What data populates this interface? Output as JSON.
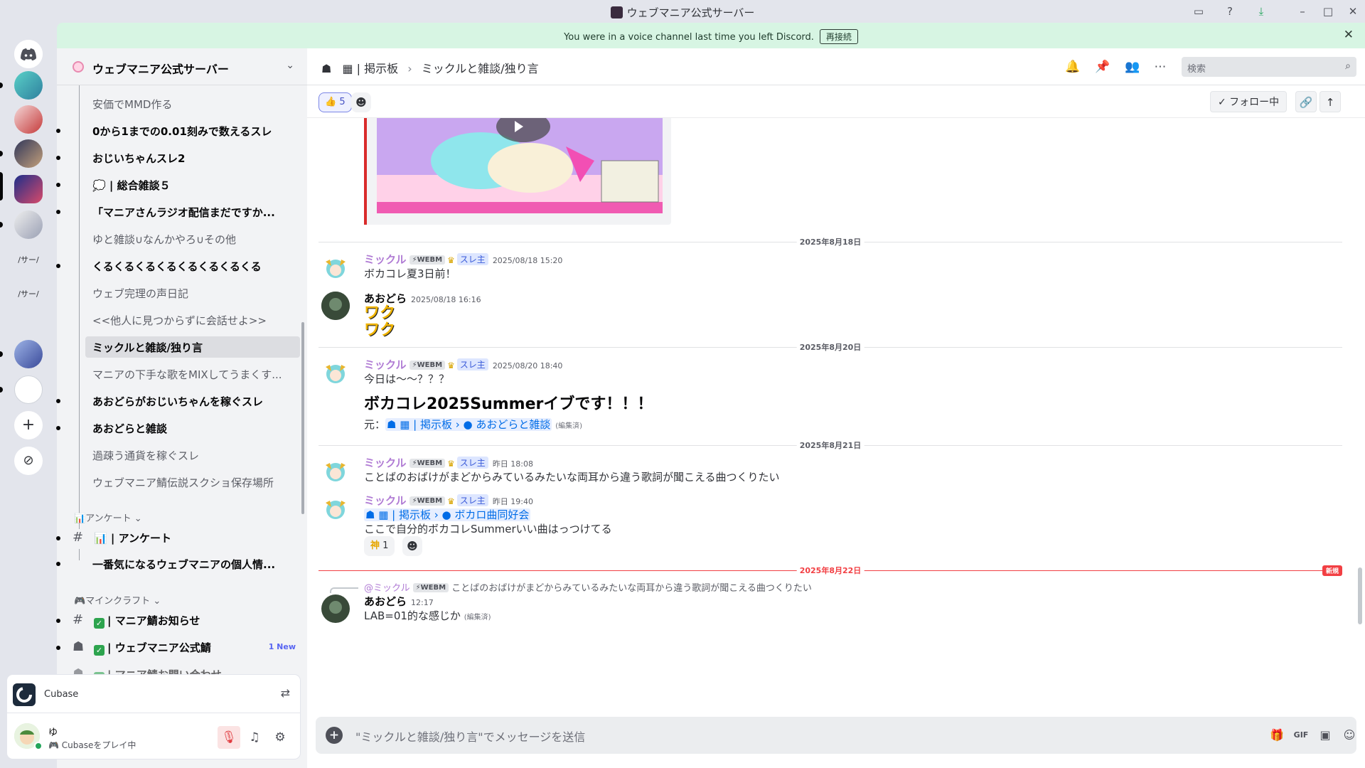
{
  "window": {
    "title": "ウェブマニア公式サーバー"
  },
  "banner": {
    "text": "You were in a voice channel last time you left Discord.",
    "reconnect": "再接続"
  },
  "guild_folder_labels": [
    "/サー/",
    "/サー/"
  ],
  "server": {
    "name": "ウェブマニア公式サーバー"
  },
  "threads": [
    {
      "label": "安価でMMD作る",
      "state": "muted"
    },
    {
      "label": "0から1までの0.01刻みで数えるスレ",
      "state": "unread"
    },
    {
      "label": "おじいちゃんスレ2",
      "state": "unread"
    },
    {
      "label": "💭 | 総合雑談５",
      "state": "unread"
    },
    {
      "label": "「マニアさんラジオ配信まだですか...",
      "state": "unread"
    },
    {
      "label": "ゆと雑談∪なんかやろ∪その他",
      "state": "muted"
    },
    {
      "label": "くるくるくるくるくるくるくるくる",
      "state": "unread"
    },
    {
      "label": "ウェブ完理の声日記",
      "state": "muted"
    },
    {
      "label": "<<他人に見つからずに会話せよ>>",
      "state": "muted"
    },
    {
      "label": "ミックルと雑談/独り言",
      "state": "selected"
    },
    {
      "label": "マニアの下手な歌をMIXしてうまくす...",
      "state": "muted"
    },
    {
      "label": "あおどらがおじいちゃんを稼ぐスレ",
      "state": "unread"
    },
    {
      "label": "あおどらと雑談",
      "state": "unread"
    },
    {
      "label": "過疎う通貨を稼ぐスレ",
      "state": "muted"
    },
    {
      "label": "ウェブマニア鯖伝説スクショ保存場所",
      "state": "muted"
    }
  ],
  "categories": {
    "survey": "📊アンケート ⌄",
    "survey_channel": "📊 | アンケート",
    "survey_thread": "一番気になるウェブマニアの個人情...",
    "minecraft": "🎮マインクラフト ⌄",
    "mc_channel1": "| マニア鯖お知らせ",
    "mc_channel2": "| ウェブマニア公式鯖",
    "mc_channel2_badge": "1 New",
    "mc_channel3": "| マニア鯖お問い合わせ"
  },
  "activity": {
    "name": "Cubase"
  },
  "user": {
    "name": "ゆ",
    "status": "🎮 Cubaseをプレイ中"
  },
  "header": {
    "forum": "| 掲示板",
    "thread": "ミックルと雑談/独り言",
    "search_placeholder": "検索"
  },
  "subbar": {
    "reaction_emoji": "👍",
    "reaction_count": "5",
    "follow": "✓ フォロー中"
  },
  "messages": {
    "d1": "2025年8月18日",
    "m1": {
      "author": "ミックル",
      "tag": "⚡WEBM",
      "role": "スレ主",
      "time": "2025/08/18 15:20",
      "text": "ボカコレ夏3日前！"
    },
    "m2": {
      "author": "あおどら",
      "time": "2025/08/18 16:16",
      "text1": "ワク",
      "text2": "ワク"
    },
    "d2": "2025年8月20日",
    "m3": {
      "author": "ミックル",
      "tag": "⚡WEBM",
      "role": "スレ主",
      "time": "2025/08/20 18:40",
      "text": "今日は〜〜？？？",
      "big": "ボカコレ2025Summerイブです！！！",
      "ref_prefix": "元：",
      "ref_forum": "| 掲示板",
      "ref_thread": "あおどらと雑談",
      "edited": "(編集済)"
    },
    "d3": "2025年8月21日",
    "m4": {
      "author": "ミックル",
      "tag": "⚡WEBM",
      "role": "スレ主",
      "time": "昨日 18:08",
      "text": "ことばのおばけがまどからみているみたいな両耳から違う歌詞が聞こえる曲つくりたい"
    },
    "m5": {
      "author": "ミックル",
      "tag": "⚡WEBM",
      "role": "スレ主",
      "time": "昨日 19:40",
      "ref_forum": "| 掲示板",
      "ref_thread": "ボカロ曲同好会",
      "text": "ここで自分的ボカコレSummerいい曲はっつけてる",
      "react_emoji": "神",
      "react_count": "1"
    },
    "d4": "2025年8月22日",
    "new_tag": "新規",
    "m6": {
      "reply_author": "@ミックル",
      "reply_tag": "⚡WEBM",
      "reply_text": "ことばのおばけがまどからみているみたいな両耳から違う歌詞が聞こえる曲つくりたい",
      "author": "あおどら",
      "time": "12:17",
      "text": "LAB=01的な感じか",
      "edited": "(編集済)"
    }
  },
  "composer": {
    "placeholder": "\"ミックルと雑談/独り言\"でメッセージを送信"
  }
}
